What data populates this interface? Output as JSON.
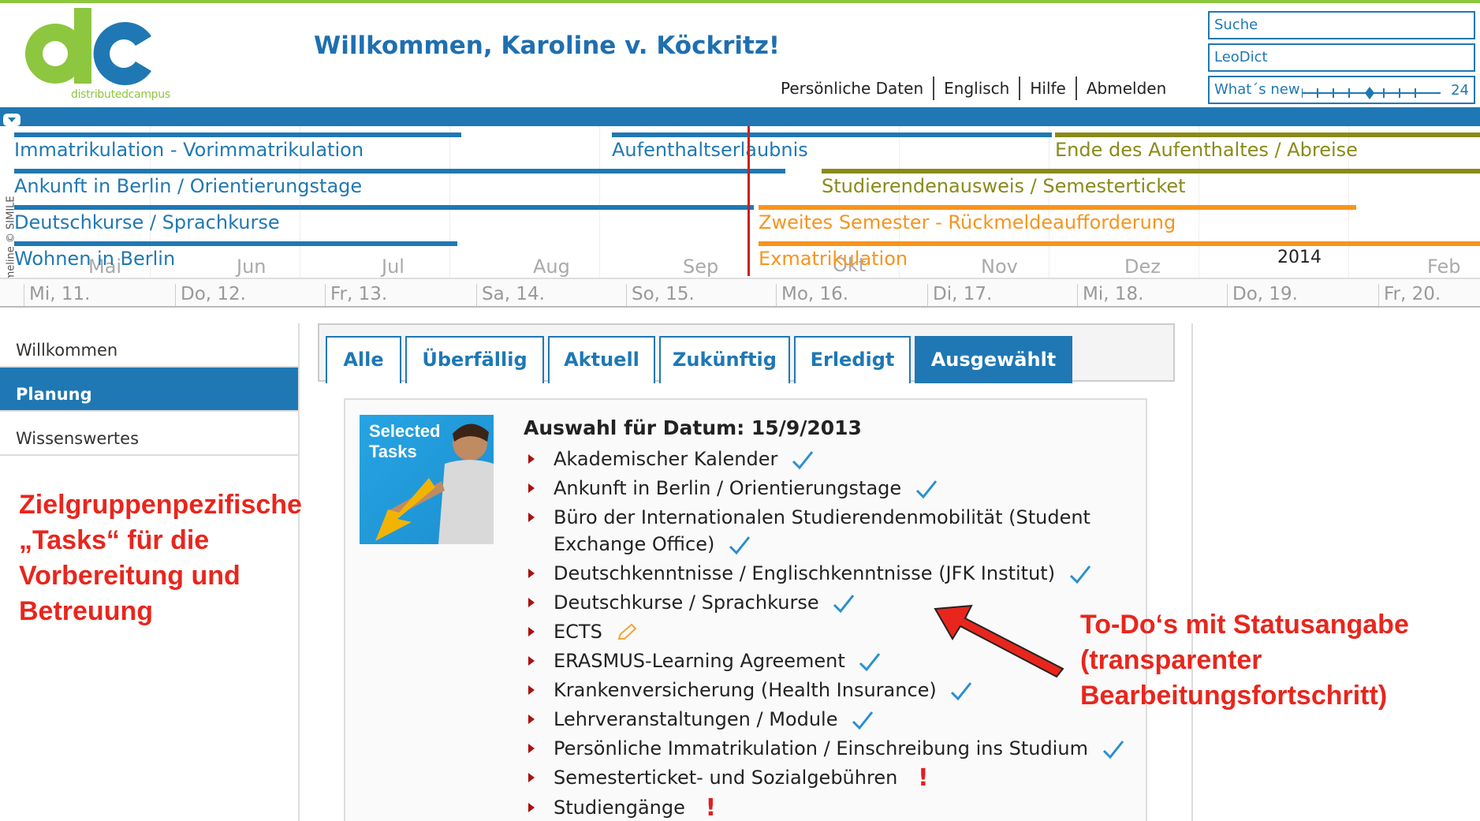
{
  "header": {
    "logo_text": "distributedcampus",
    "welcome": "Willkommen, Karoline v. Köckritz!",
    "links": [
      "Persönliche Daten",
      "Englisch",
      "Hilfe",
      "Abmelden"
    ],
    "search_placeholder": "Suche",
    "leodict_placeholder": "LeoDict",
    "whats_new_label": "What´s new",
    "whats_new_count": "24"
  },
  "timeline": {
    "credit": "Timeline © SIMILE",
    "events": [
      "Immatrikulation - Vorimmatrikulation",
      "Aufenthaltserlaubnis",
      "Ende des Aufenthaltes / Abreise",
      "Ankunft in Berlin / Orientierungstage",
      "Studierendenausweis / Semesterticket",
      "Deutschkurse / Sprachkurse",
      "Zweites Semester - Rückmeldeaufforderung",
      "Wohnen in Berlin",
      "Exmatrikulation"
    ],
    "months": [
      "Mai",
      "Jun",
      "Jul",
      "Aug",
      "Sep",
      "Okt",
      "Nov",
      "Dez",
      "Feb"
    ],
    "year": "2014",
    "days": [
      "Mi, 11.",
      "Do, 12.",
      "Fr, 13.",
      "Sa, 14.",
      "So, 15.",
      "Mo, 16.",
      "Di, 17.",
      "Mi, 18.",
      "Do, 19.",
      "Fr, 20."
    ]
  },
  "sidebar": {
    "items": [
      "Willkommen",
      "Planung",
      "Wissenswertes"
    ],
    "active": "Planung"
  },
  "tabs": [
    "Alle",
    "Überfällig",
    "Aktuell",
    "Zukünftig",
    "Erledigt",
    "Ausgewählt"
  ],
  "selected_tab": "Ausgewählt",
  "content": {
    "image_text": [
      "Selected",
      "Tasks"
    ],
    "heading": "Auswahl für Datum: 15/9/2013",
    "tasks": [
      {
        "label": "Akademischer Kalender",
        "status": "done"
      },
      {
        "label": "Ankunft in Berlin / Orientierungstage",
        "status": "done"
      },
      {
        "label": "Büro der Internationalen Studierendenmobilität (Student",
        "label2": "Exchange Office)",
        "status": "done"
      },
      {
        "label": "Deutschkenntnisse / Englischkenntnisse (JFK Institut)",
        "status": "done"
      },
      {
        "label": "Deutschkurse / Sprachkurse",
        "status": "done"
      },
      {
        "label": "ECTS",
        "status": "in-progress"
      },
      {
        "label": "ERASMUS-Learning Agreement",
        "status": "done"
      },
      {
        "label": "Krankenversicherung (Health Insurance)",
        "status": "done"
      },
      {
        "label": "Lehrveranstaltungen / Module",
        "status": "done"
      },
      {
        "label": "Persönliche Immatrikulation / Einschreibung ins Studium",
        "status": "done"
      },
      {
        "label": "Semesterticket- und Sozialgebühren",
        "status": "overdue"
      },
      {
        "label": "Studiengänge",
        "status": "overdue"
      }
    ]
  },
  "annotations": {
    "left": [
      "Zielgruppenpezifische",
      "„Tasks“  für die",
      "Vorbereitung und",
      "Betreuung"
    ],
    "right": [
      "To-Do‘s mit Statusangabe",
      "(transparenter",
      "Bearbeitungsfortschritt)"
    ]
  },
  "colors": {
    "brand_blue": "#1f78b4",
    "brand_green": "#8dc63f",
    "orange": "#f7941d",
    "olive": "#8a8a1a",
    "annotation_red": "#e8261d"
  }
}
